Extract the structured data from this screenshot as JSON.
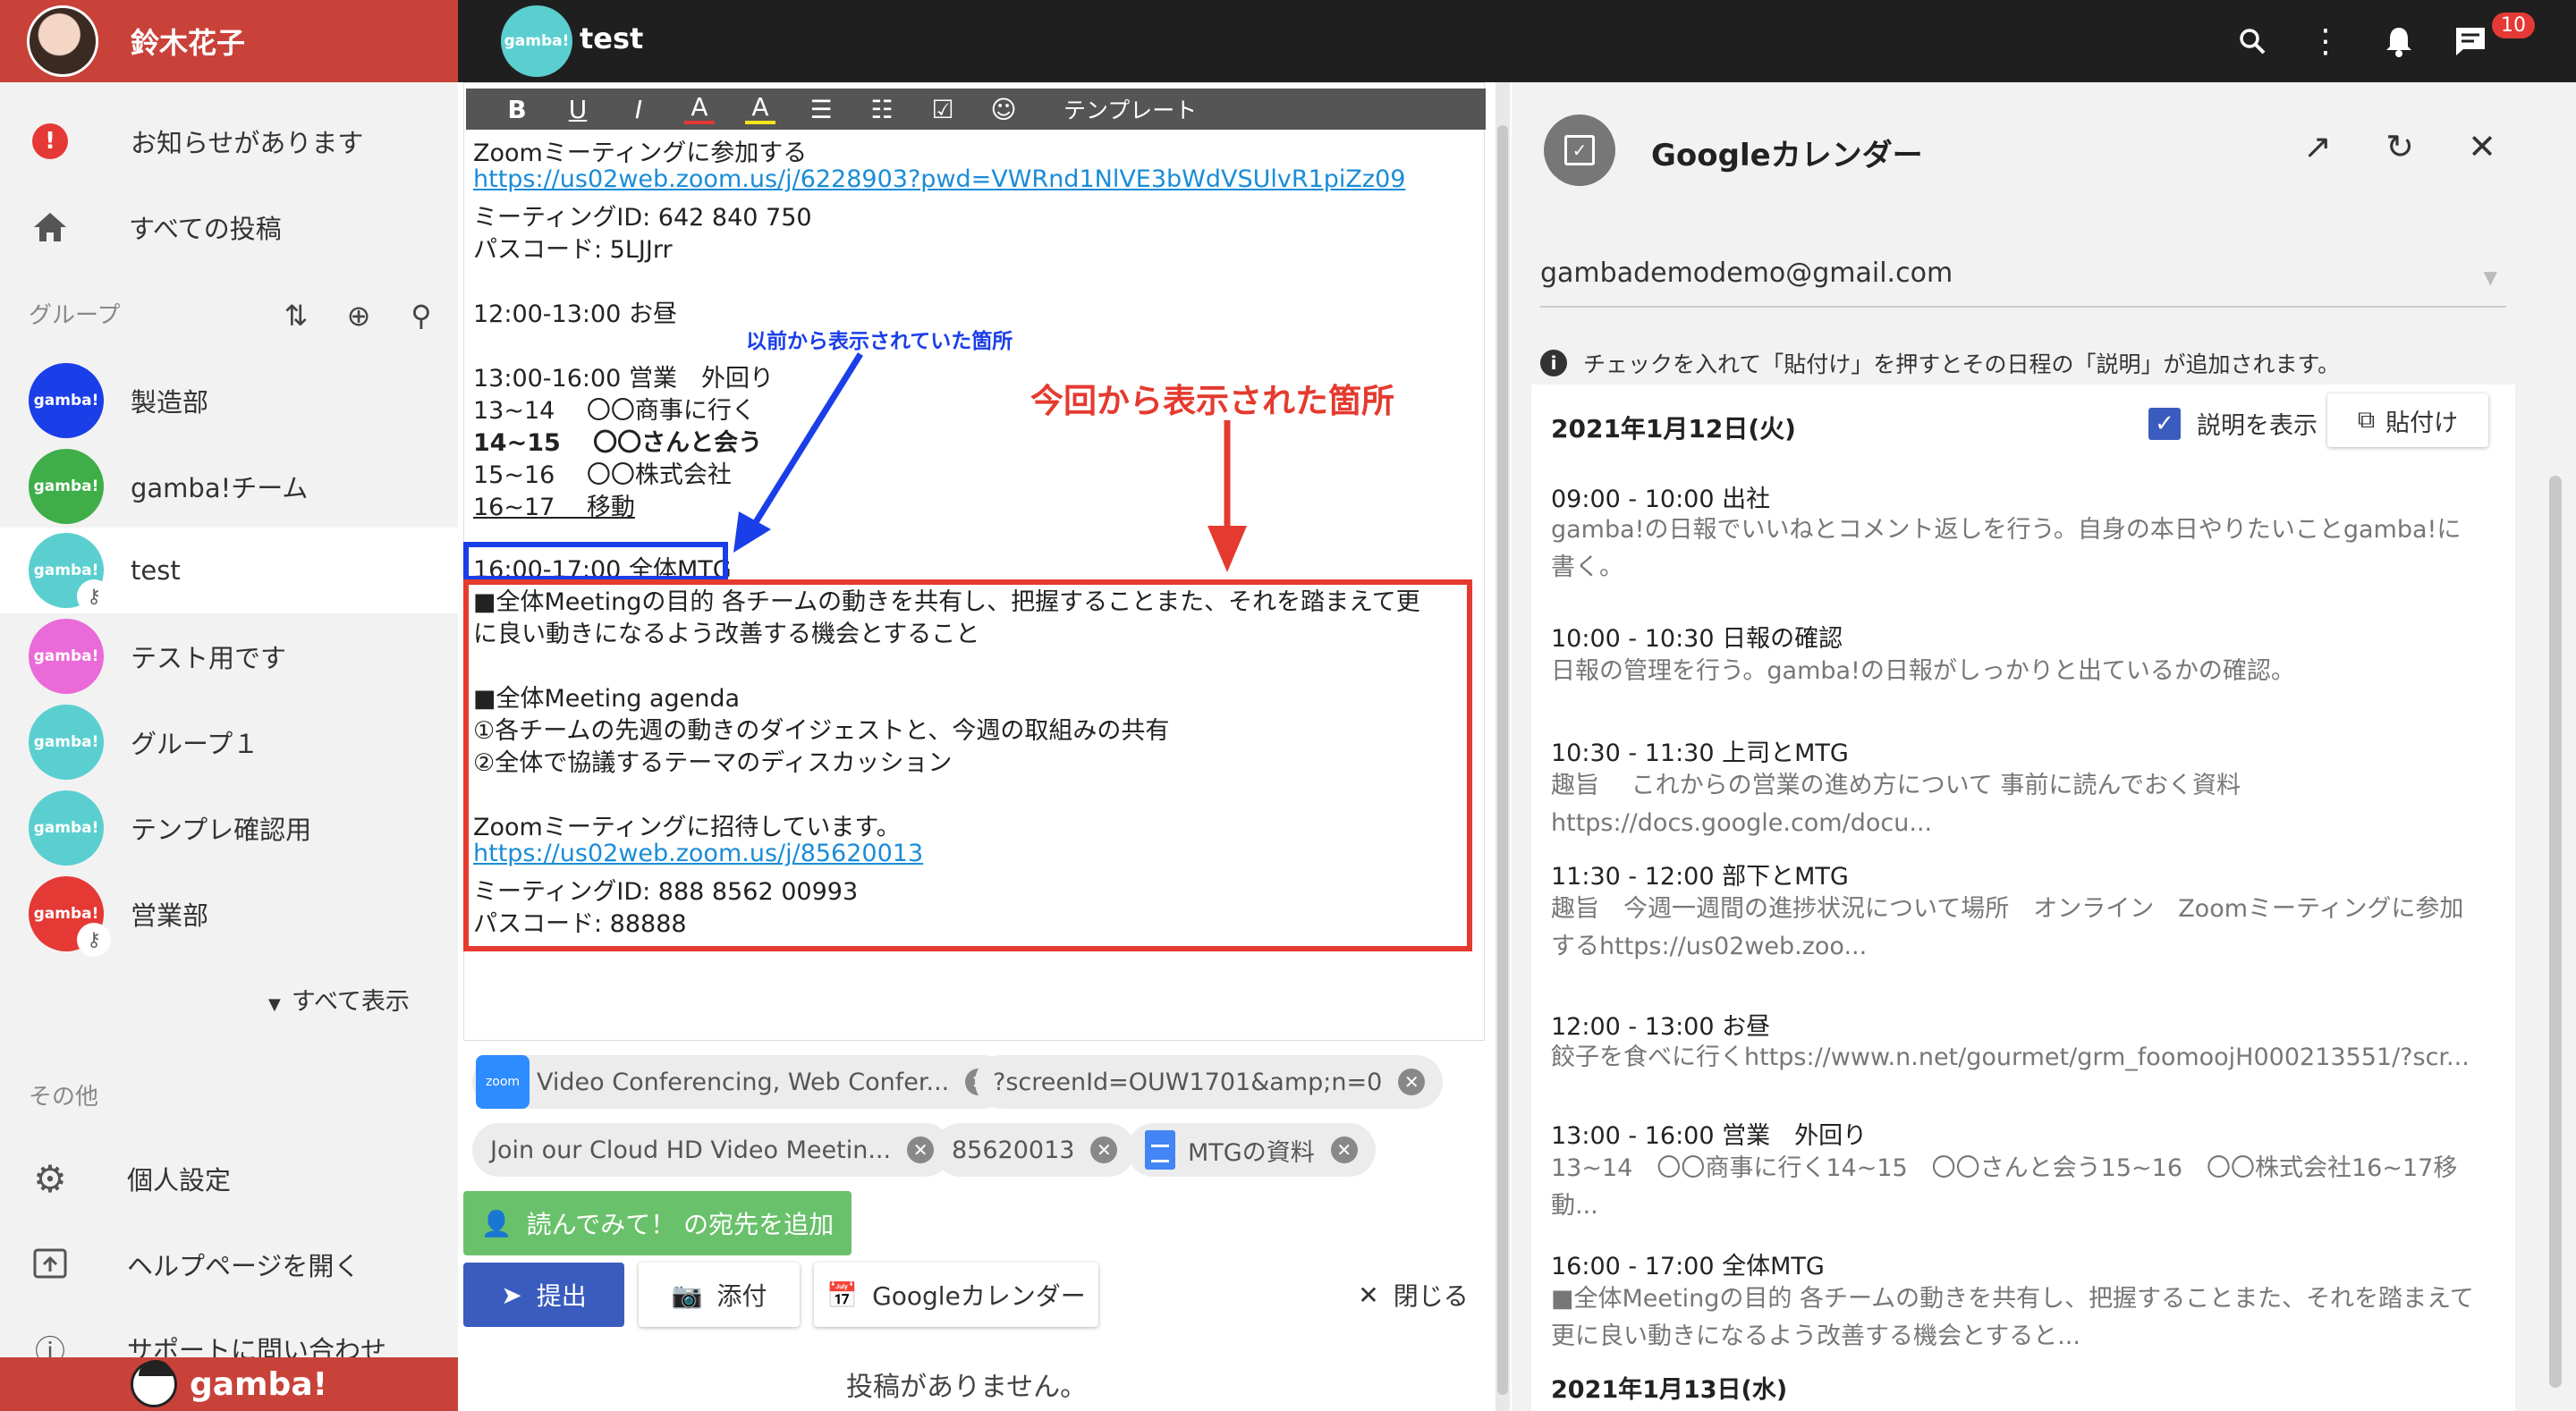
{
  "user": {
    "name": "鈴木花子"
  },
  "sidebar": {
    "notice": "お知らせがあります",
    "all_posts": "すべての投稿",
    "groups_title": "グループ",
    "groups": [
      {
        "label": "製造部",
        "avatar_text": "gamba!",
        "color": "#1a3ee8"
      },
      {
        "label": "gamba!チーム",
        "avatar_text": "gamba!",
        "color": "#3fae49"
      },
      {
        "label": "test",
        "avatar_text": "gamba!",
        "color": "#5bcfcf"
      },
      {
        "label": "テスト用です",
        "avatar_text": "gamba!",
        "color": "#ea6ad8"
      },
      {
        "label": "グループ１",
        "avatar_text": "gamba!",
        "color": "#5bcfcf"
      },
      {
        "label": "テンプレ確認用",
        "avatar_text": "gamba!",
        "color": "#5bcfcf"
      },
      {
        "label": "営業部",
        "avatar_text": "gamba!",
        "color": "#e53935"
      }
    ],
    "show_all": "すべて表示",
    "other_title": "その他",
    "settings": "個人設定",
    "help": "ヘルプページを開く",
    "support": "サポートに問い合わせ",
    "brand": "gamba!"
  },
  "topbar": {
    "group_avatar_text": "gamba!",
    "title": "test",
    "badge": "10"
  },
  "editor": {
    "toolbar": {
      "bold": "B",
      "underline": "U",
      "italic": "I",
      "color": "A",
      "highlight": "A",
      "template": "テンプレート"
    },
    "lines": [
      "Zoomミーティングに参加する",
      "https://us02web.zoom.us/j/6228903?pwd=VWRnd1NlVE3bWdVSUlvR1piZz09",
      "ミーティングID: 642 840 750",
      "パスコード: 5LJJrr",
      "12:00-13:00  お昼",
      "13:00-16:00  営業　外回り",
      "13~14　 〇〇商事に行く",
      "14~15　 〇〇さんと会う",
      "15~16　 〇〇株式会社",
      "16~17　 移動",
      "16:00-17:00  全体MTG",
      " ■全体Meetingの目的 各チームの動きを共有し、把握することまた、それを踏まえて更",
      "に良い動きになるよう改善する機会とすること",
      " ■全体Meeting agenda",
      "①各チームの先週の動きのダイジェストと、今週の取組みの共有",
      "②全体で協議するテーマのディスカッション",
      "Zoomミーティングに招待しています。",
      "https://us02web.zoom.us/j/85620013",
      " ミーティングID: 888 8562 00993",
      "パスコード: 88888"
    ],
    "annotation_blue": "以前から表示されていた箇所",
    "annotation_red": "今回から表示された箇所"
  },
  "chips": [
    {
      "label": "Video Conferencing, Web Confer...",
      "icon": "zoom"
    },
    {
      "label": "?screenId=OUW1701&amp;n=0"
    },
    {
      "label": "Join our Cloud HD Video Meetin..."
    },
    {
      "label": "85620013"
    },
    {
      "label": "MTGの資料",
      "icon": "doc"
    }
  ],
  "actions": {
    "add_recipient": "読んでみて！ の宛先を追加",
    "submit": "提出",
    "attach": "添付",
    "gcal": "Googleカレンダー",
    "close": "閉じる",
    "no_posts": "投稿がありません。"
  },
  "calendar": {
    "title": "Googleカレンダー",
    "account": "gambademodemo@gmail.com",
    "info": "チェックを入れて「貼付け」を押すとその日程の「説明」が追加されます。",
    "date": "2021年1月12日(火)",
    "show_desc": "説明を表示",
    "paste": "貼付け",
    "events": [
      {
        "title": "09:00 - 10:00 出社",
        "desc": "gamba!の日報でいいねとコメント返しを行う。自身の本日やりたいことgamba!に書く。"
      },
      {
        "title": "10:00 - 10:30 日報の確認",
        "desc": "日報の管理を行う。gamba!の日報がしっかりと出ているかの確認。"
      },
      {
        "title": "10:30 - 11:30 上司とMTG",
        "desc": "趣旨　 これからの営業の進め方について 事前に読んでおく資料https://docs.google.com/docu..."
      },
      {
        "title": "11:30 - 12:00 部下とMTG",
        "desc": "趣旨　今週一週間の進捗状況について場所　オンライン　Zoomミーティングに参加するhttps://us02web.zoo..."
      },
      {
        "title": "12:00 - 13:00 お昼",
        "desc": "餃子を食べに行くhttps://www.n.net/gourmet/grm_foomoojH000213551/?scr..."
      },
      {
        "title": "13:00 - 16:00 営業　外回り",
        "desc": "13~14　〇〇商事に行く14~15　〇〇さんと会う15~16　〇〇株式会社16~17移動..."
      },
      {
        "title": "16:00 - 17:00 全体MTG",
        "desc": "■全体Meetingの目的 各チームの動きを共有し、把握することまた、それを踏まえて更に良い動きになるよう改善する機会とすると..."
      }
    ],
    "next_date": "2021年1月13日(水)"
  }
}
